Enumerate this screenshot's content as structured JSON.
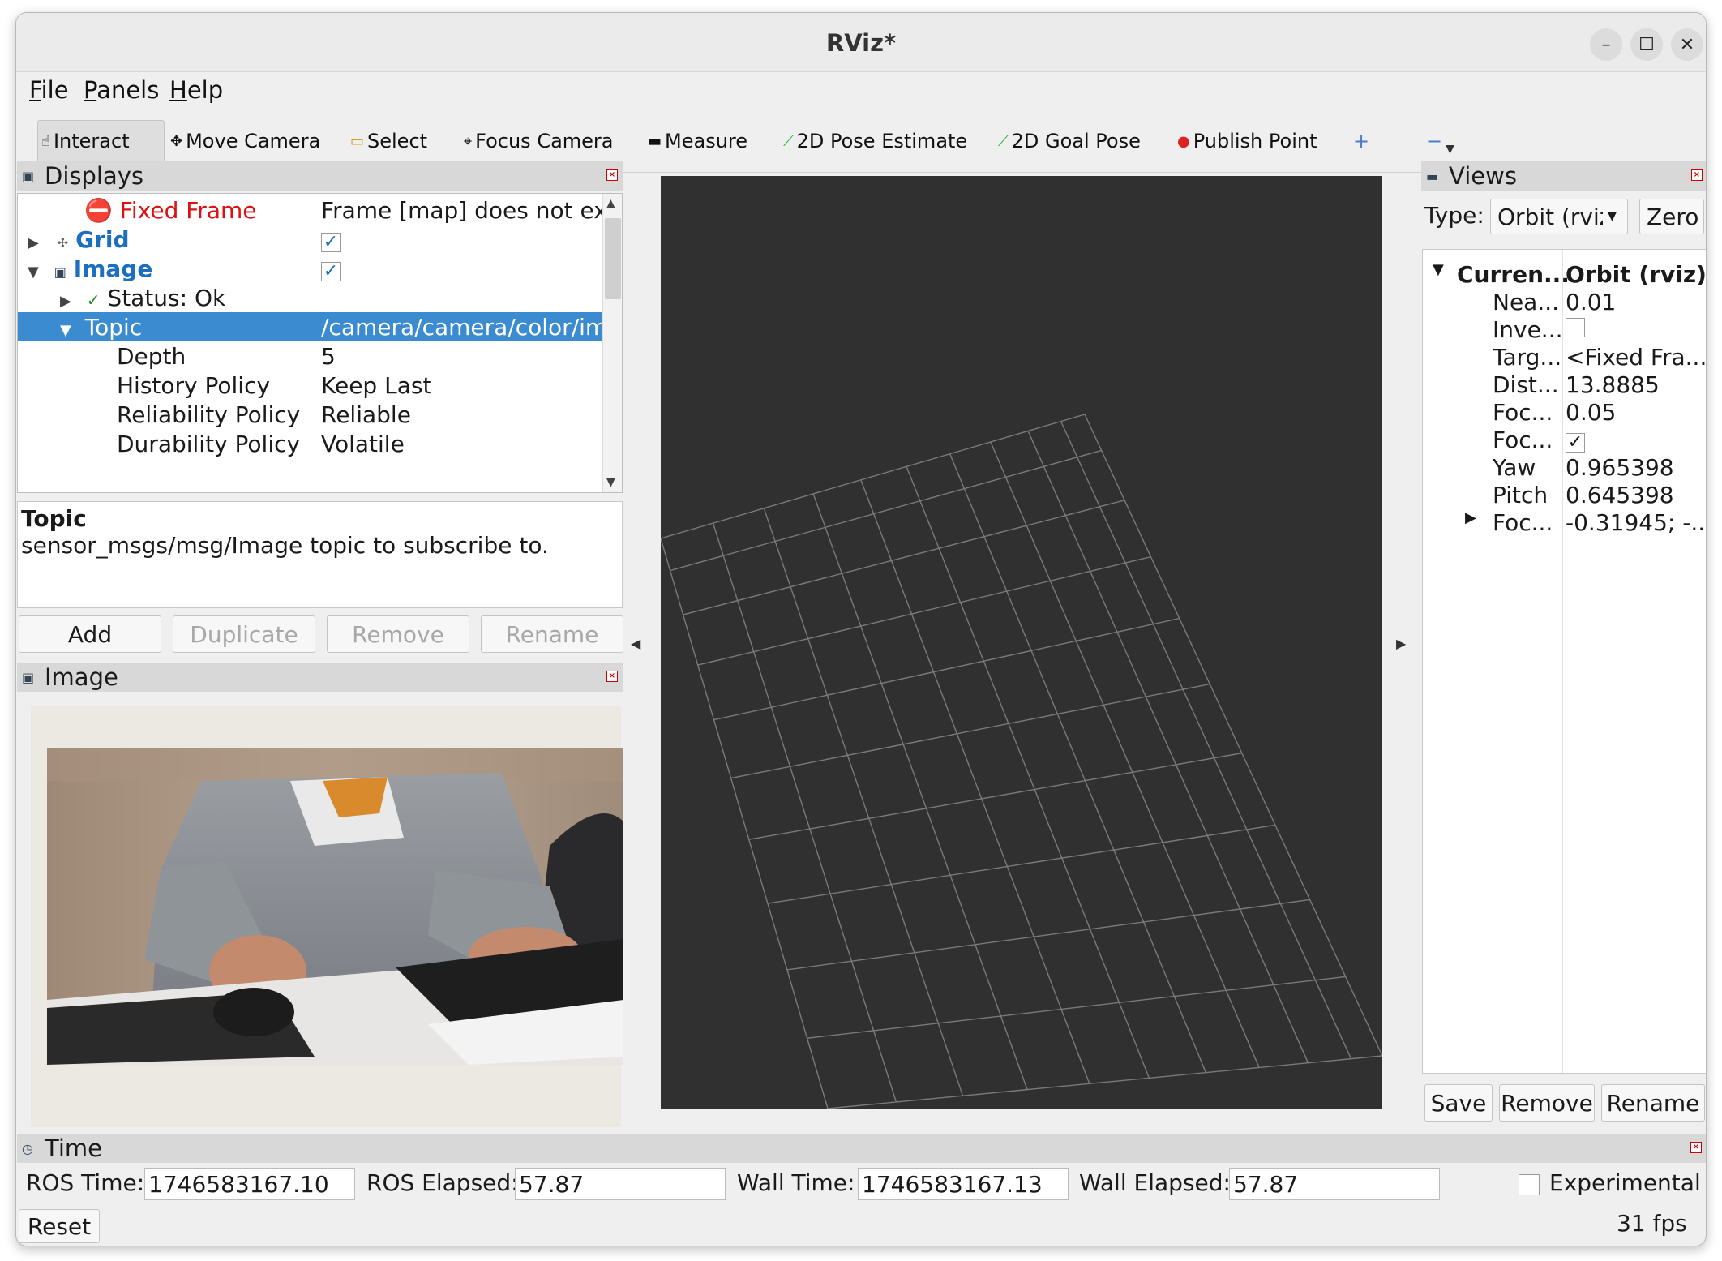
{
  "window": {
    "title": "RViz*",
    "minimize": "–",
    "maximize": "☐",
    "close": "✕"
  },
  "menu": [
    {
      "key": "F",
      "rest": "ile"
    },
    {
      "key": "P",
      "rest": "anels"
    },
    {
      "key": "H",
      "rest": "elp"
    }
  ],
  "toolbar": {
    "interact": "Interact",
    "move_camera": "Move Camera",
    "select": "Select",
    "focus_camera": "Focus Camera",
    "measure": "Measure",
    "pose_estimate": "2D Pose Estimate",
    "goal_pose": "2D Goal Pose",
    "publish_point": "Publish Point",
    "add_tool": "+",
    "remove_tool": "−"
  },
  "displays": {
    "header": "Displays",
    "rows": {
      "fixed_frame": {
        "label": "Fixed Frame",
        "value": "Frame [map] does not exis"
      },
      "grid": {
        "label": "Grid",
        "checked": true
      },
      "image": {
        "label": "Image",
        "checked": true
      },
      "status": {
        "label": "Status: Ok"
      },
      "topic": {
        "label": "Topic",
        "value": "/camera/camera/color/im..."
      },
      "depth": {
        "label": "Depth",
        "value": "5"
      },
      "history": {
        "label": "History Policy",
        "value": "Keep Last"
      },
      "reliability": {
        "label": "Reliability Policy",
        "value": "Reliable"
      },
      "durability": {
        "label": "Durability Policy",
        "value": "Volatile"
      }
    },
    "description": {
      "title": "Topic",
      "text": "sensor_msgs/msg/Image topic to subscribe to."
    },
    "buttons": {
      "add": "Add",
      "duplicate": "Duplicate",
      "remove": "Remove",
      "rename": "Rename"
    }
  },
  "image_panel": {
    "header": "Image"
  },
  "views": {
    "header": "Views",
    "type_label": "Type:",
    "type_value": "Orbit (rviz",
    "zero": "Zero",
    "current_label": "Curren...",
    "current_value": "Orbit (rviz)",
    "props": [
      {
        "key": "Nea...",
        "value": "0.01"
      },
      {
        "key": "Inve...",
        "value": ""
      },
      {
        "key": "Targ...",
        "value": "<Fixed Fra..."
      },
      {
        "key": "Dist...",
        "value": "13.8885"
      },
      {
        "key": "Foc...",
        "value": "0.05"
      },
      {
        "key": "Foc...",
        "value": "✓"
      },
      {
        "key": "Yaw",
        "value": "0.965398"
      },
      {
        "key": "Pitch",
        "value": "0.645398"
      },
      {
        "key": "Foc...",
        "value": "-0.31945; -..."
      }
    ],
    "buttons": {
      "save": "Save",
      "remove": "Remove",
      "rename": "Rename"
    }
  },
  "time": {
    "header": "Time",
    "ros_time_label": "ROS Time:",
    "ros_time": "1746583167.10",
    "ros_elapsed_label": "ROS Elapsed:",
    "ros_elapsed": "57.87",
    "wall_time_label": "Wall Time:",
    "wall_time": "1746583167.13",
    "wall_elapsed_label": "Wall Elapsed:",
    "wall_elapsed": "57.87",
    "experimental": "Experimental",
    "reset": "Reset",
    "fps": "31 fps"
  },
  "colors": {
    "selection": "#3a8bd0",
    "viewport_bg": "#303030",
    "grid_line": "#7a7a7a",
    "link_blue": "#1c6fbe",
    "error_red": "#d11111"
  }
}
